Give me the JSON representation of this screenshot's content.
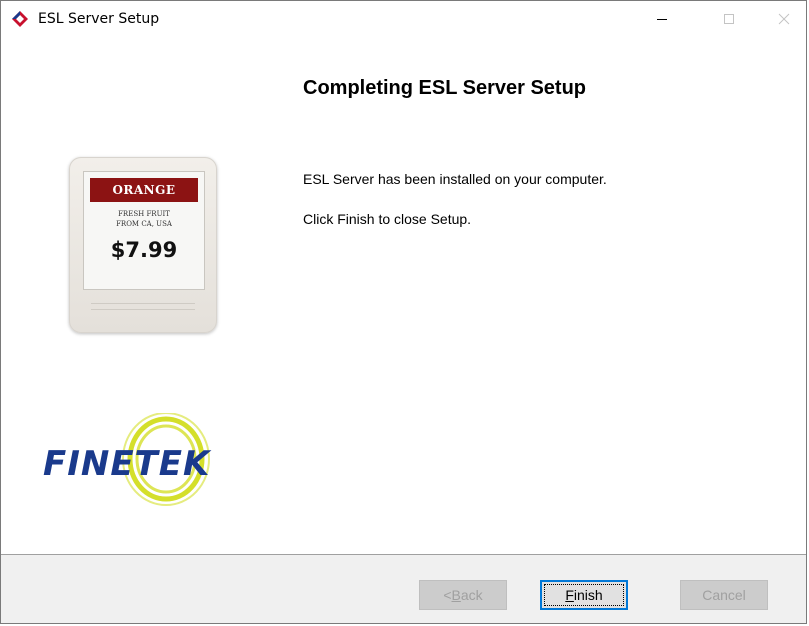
{
  "window": {
    "title": "ESL Server Setup",
    "icons": {
      "app": "finetek-diamond-icon",
      "minimize": "minimize-icon",
      "maximize": "maximize-icon",
      "close": "close-icon"
    }
  },
  "content": {
    "heading": "Completing ESL Server Setup",
    "message_installed": "ESL Server has been installed on your computer.",
    "message_finish": "Click Finish to close Setup."
  },
  "esl_tag": {
    "banner": "ORANGE",
    "line1": "FRESH FRUIT",
    "line2": "FROM CA, USA",
    "price": "$7.99",
    "banner_color": "#8c1313"
  },
  "logo": {
    "text": "FINETEK",
    "color": "#1a3a8c",
    "ring_color": "#d4df2a"
  },
  "buttons": {
    "back": {
      "prefix": "< ",
      "mnemonic": "B",
      "rest": "ack",
      "enabled": false
    },
    "finish": {
      "mnemonic": "F",
      "rest": "inish",
      "enabled": true
    },
    "cancel": {
      "label": "Cancel",
      "enabled": false
    }
  }
}
